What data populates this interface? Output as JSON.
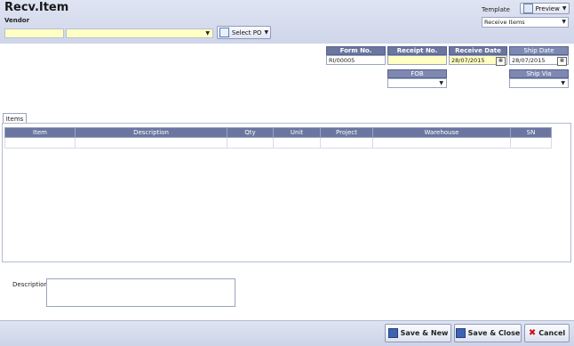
{
  "app": {
    "title": "Recv.Item"
  },
  "vendor": {
    "label": "Vendor",
    "code_value": "",
    "name_value": ""
  },
  "select_po": {
    "label": "Select PO"
  },
  "template": {
    "label": "Template",
    "value": "Receive Items",
    "preview_label": "Preview"
  },
  "form": {
    "form_no_label": "Form No.",
    "form_no_value": "RI/00005",
    "receipt_no_label": "Receipt No.",
    "receipt_no_value": "",
    "receive_date_label": "Receive Date",
    "receive_date_value": "28/07/2015",
    "ship_date_label": "Ship Date",
    "ship_date_value": "28/07/2015",
    "fob_label": "FOB",
    "fob_value": "",
    "ship_via_label": "Ship Via",
    "ship_via_value": ""
  },
  "items_tab": {
    "label": "Items"
  },
  "grid": {
    "columns": [
      "Item",
      "Description",
      "Qty",
      "Unit",
      "Project",
      "Warehouse",
      "SN"
    ],
    "rows": []
  },
  "description": {
    "label": "Description",
    "value": ""
  },
  "footer": {
    "save_new_label": "Save & New",
    "save_close_label": "Save & Close",
    "cancel_label": "Cancel"
  },
  "colors": {
    "header_blue": "#6a76a0",
    "field_yellow": "#ffffc4",
    "bar_bg": "#d7ddee"
  },
  "icons": [
    "select-po-icon",
    "preview-icon",
    "calendar-icon",
    "save-icon",
    "cancel-icon",
    "chevron-down-icon"
  ]
}
